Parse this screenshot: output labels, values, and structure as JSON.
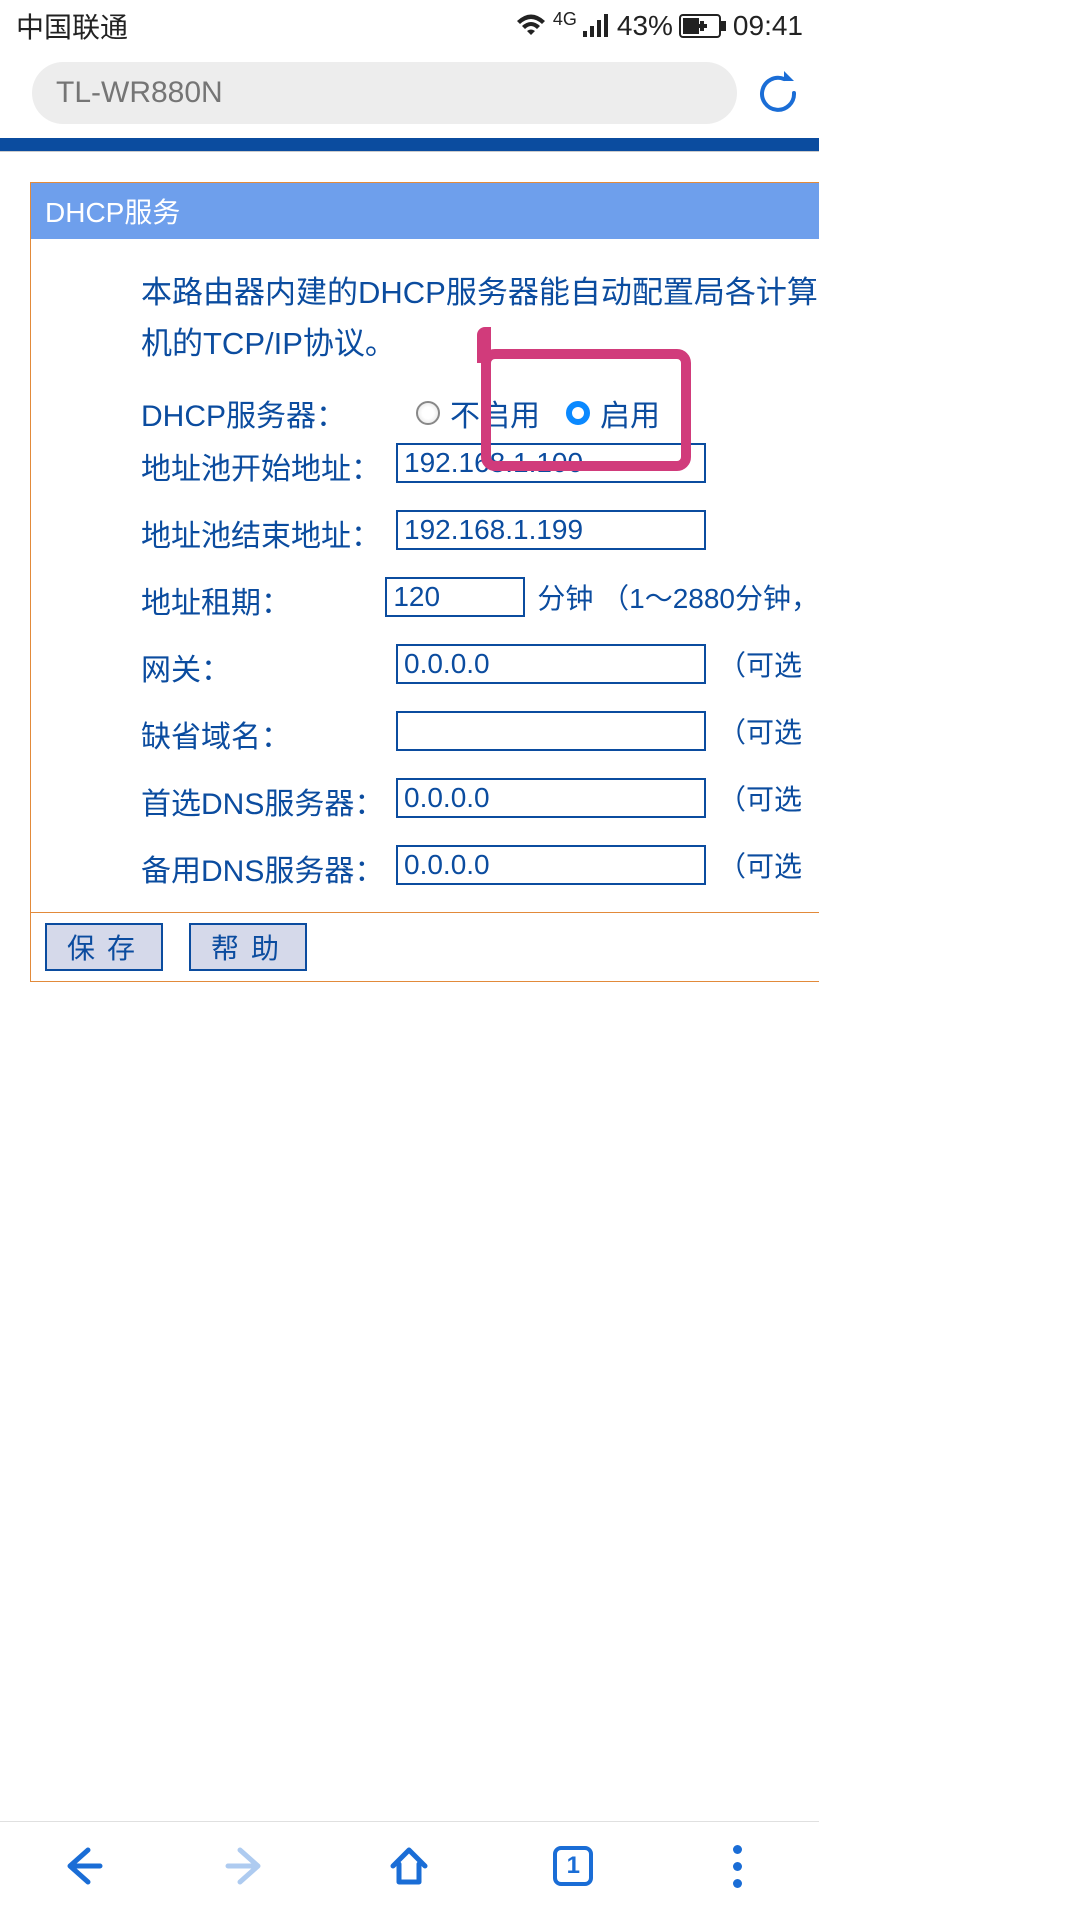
{
  "status": {
    "carrier": "中国联通",
    "network": "4G",
    "battery": "43%",
    "time": "09:41"
  },
  "urlbar": {
    "placeholder": "TL-WR880N"
  },
  "panel": {
    "title": "DHCP服务",
    "intro": "本路由器内建的DHCP服务器能自动配置局各计算机的TCP/IP协议。"
  },
  "form": {
    "dhcp_label": "DHCP服务器：",
    "radio_disable": "不启用",
    "radio_enable": "启用",
    "start_label": "地址池开始地址：",
    "start_value": "192.168.1.100",
    "end_label": "地址池结束地址：",
    "end_value": "192.168.1.199",
    "lease_label": "地址租期：",
    "lease_value": "120",
    "lease_suffix": "分钟 （1～2880分钟，",
    "gateway_label": "网关：",
    "gateway_value": "0.0.0.0",
    "optional": "（可选",
    "domain_label": "缺省域名：",
    "domain_value": "",
    "dns1_label": "首选DNS服务器：",
    "dns1_value": "0.0.0.0",
    "dns2_label": "备用DNS服务器：",
    "dns2_value": "0.0.0.0"
  },
  "buttons": {
    "save": "保存",
    "help": "帮助"
  },
  "nav": {
    "tabs": "1"
  }
}
